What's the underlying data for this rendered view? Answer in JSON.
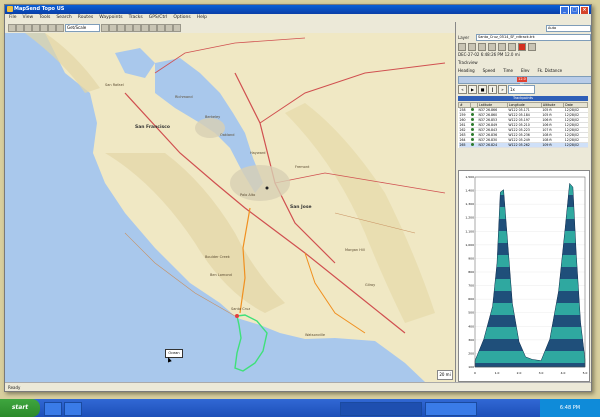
{
  "window": {
    "title": "MapSend Topo US"
  },
  "menu": [
    "File",
    "View",
    "Tools",
    "Search",
    "Routes",
    "Waypoints",
    "Tracks",
    "GPS/Ctrl",
    "Options",
    "Help"
  ],
  "toolbar": {
    "zoom_combo": "Get/Scale"
  },
  "map": {
    "labels": [
      {
        "text": "San Rafael"
      },
      {
        "text": "Richmond"
      },
      {
        "text": "Berkeley"
      },
      {
        "text": "San Francisco"
      },
      {
        "text": "Oakland"
      },
      {
        "text": "Hayward"
      },
      {
        "text": "Fremont"
      },
      {
        "text": "Palo Alto"
      },
      {
        "text": "San Jose"
      },
      {
        "text": "Santa Cruz"
      },
      {
        "text": "Boulder Creek"
      },
      {
        "text": "Ben Lomond"
      },
      {
        "text": "Gilroy"
      },
      {
        "text": "Morgan Hill"
      },
      {
        "text": "Watsonville"
      }
    ],
    "tooltip": "Ocean",
    "scale": "20 mi"
  },
  "side": {
    "view_combo": "Auto",
    "map_label": "Layer",
    "map_value": "Santa_Cruz_0514_SF_rdtrack.trk",
    "track_line": "DEC-27-02 6:48:26 PM  12.0 mi",
    "section_label": "Trackview",
    "headers": [
      "Heading",
      "Speed",
      "Time",
      "Elev",
      "Fk. Distance"
    ],
    "slider_label": "12.0 mi",
    "speed_combo": "1x",
    "list_title": "Trackpoints",
    "columns": [
      "#",
      "Latitude",
      "Longitude",
      "Altitude",
      "Date"
    ],
    "rows": [
      [
        "258",
        "N37 26.866",
        "W122 05.171",
        "105 ft",
        "12/28/02"
      ],
      [
        "259",
        "N37 26.860",
        "W122 05.184",
        "105 ft",
        "12/28/02"
      ],
      [
        "260",
        "N37 26.853",
        "W122 05.197",
        "106 ft",
        "12/28/02"
      ],
      [
        "261",
        "N37 26.849",
        "W122 05.210",
        "106 ft",
        "12/28/02"
      ],
      [
        "262",
        "N37 26.843",
        "W122 05.223",
        "107 ft",
        "12/28/02"
      ],
      [
        "263",
        "N37 26.836",
        "W122 05.236",
        "108 ft",
        "12/28/02"
      ],
      [
        "264",
        "N37 26.830",
        "W122 05.249",
        "108 ft",
        "12/28/02"
      ],
      [
        "265",
        "N37 26.824",
        "W122 05.262",
        "109 ft",
        "12/28/02"
      ]
    ],
    "profile_y_ticks": [
      "1,500",
      "1,400",
      "1,300",
      "1,200",
      "1,100",
      "1,000",
      "900",
      "800",
      "700",
      "600",
      "500",
      "400",
      "300",
      "200",
      "100"
    ],
    "profile_x_ticks": [
      "0",
      "1.0",
      "2.0",
      "3.0",
      "4.0",
      "5.0"
    ]
  },
  "status": {
    "text": "Ready"
  },
  "taskbar": {
    "start": "start",
    "clock": "6:48 PM"
  },
  "colors": {
    "title": "#0a4fc8",
    "water": "#a9c8ec",
    "land": "#f0e8c4",
    "track": "#3fe07a",
    "road": "#d05050",
    "profile_fill": "#1f4f7a",
    "profile_alt": "#2fa8a0"
  },
  "chart_data": {
    "type": "area",
    "x": [
      0.0,
      0.4,
      0.8,
      1.0,
      1.15,
      1.3,
      1.5,
      1.7,
      2.0,
      2.3,
      2.6,
      3.0,
      3.4,
      3.8,
      4.1,
      4.3,
      4.45,
      4.6,
      4.8,
      5.0
    ],
    "values": [
      50,
      220,
      480,
      820,
      1380,
      1400,
      950,
      500,
      200,
      80,
      60,
      50,
      220,
      600,
      1100,
      1450,
      1420,
      900,
      350,
      60
    ],
    "ylim": [
      0,
      1500
    ]
  }
}
